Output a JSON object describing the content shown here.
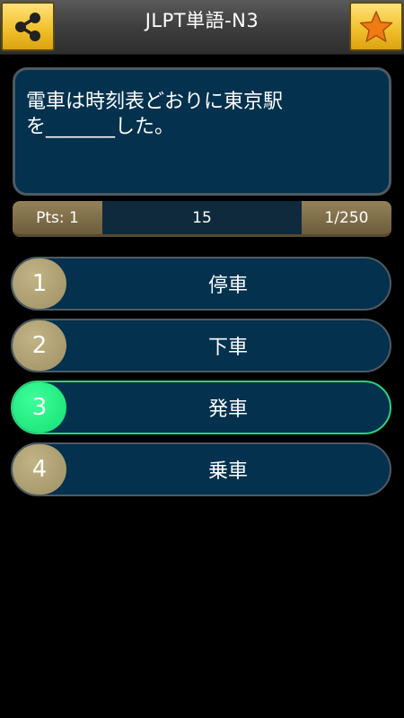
{
  "header": {
    "title": "JLPT単語-N3",
    "share_icon": "share-icon",
    "favorite_icon": "star-icon"
  },
  "question": {
    "text": "電車は時刻表どおりに東京駅\nを_______した。"
  },
  "status": {
    "points": "Pts: 1",
    "timer": "15",
    "progress": "1/250"
  },
  "answers": [
    {
      "number": "1",
      "label": "停車"
    },
    {
      "number": "2",
      "label": "下車"
    },
    {
      "number": "3",
      "label": "発車"
    },
    {
      "number": "4",
      "label": "乗車"
    }
  ],
  "colors": {
    "accent_gold": "#f2c12e",
    "selected_green": "#15de73",
    "panel_blue": "#03314e"
  }
}
